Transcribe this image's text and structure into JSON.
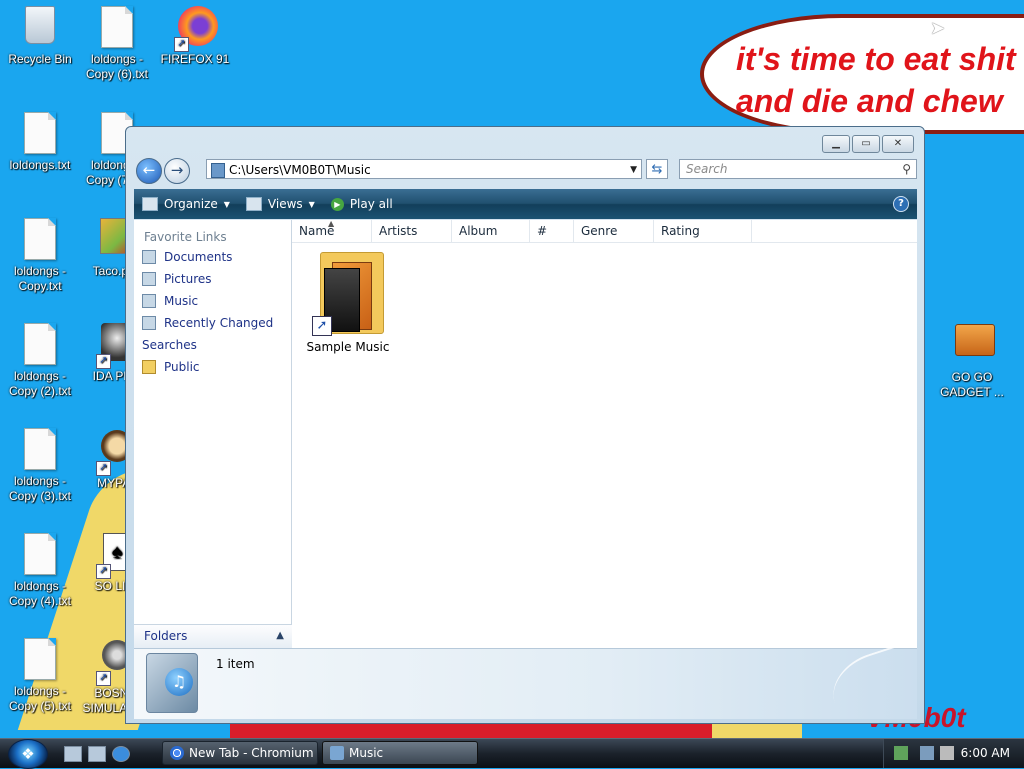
{
  "wallpaper": {
    "line1": "it's time to eat shit",
    "line2": "and die and chew",
    "line3": "bubble",
    "tag": "VM0b0t"
  },
  "desktop_icons": [
    {
      "label": "Recycle Bin"
    },
    {
      "label": "loldongs - Copy (6).txt"
    },
    {
      "label": "FIREFOX 91"
    },
    {
      "label": "loldongs.txt"
    },
    {
      "label": "loldongs - Copy (7).txt"
    },
    {
      "label": "loldongs - Copy.txt"
    },
    {
      "label": "Taco.png"
    },
    {
      "label": "loldongs - Copy (2).txt"
    },
    {
      "label": "IDA PRO"
    },
    {
      "label": "loldongs - Copy (3).txt"
    },
    {
      "label": "MYPAL"
    },
    {
      "label": "loldongs - Copy (4).txt"
    },
    {
      "label": "SO LIT!!"
    },
    {
      "label": "loldongs - Copy (5).txt"
    },
    {
      "label": "BOSNIA SIMULATOR"
    },
    {
      "label": "GO GO GADGET ..."
    }
  ],
  "window": {
    "title": "Music",
    "address": "C:\\Users\\VM0B0T\\Music",
    "search_placeholder": "Search",
    "toolbar": {
      "organize": "Organize",
      "views": "Views",
      "play_all": "Play all"
    },
    "favorite_links_title": "Favorite Links",
    "favorite_links": [
      {
        "label": "Documents"
      },
      {
        "label": "Pictures"
      },
      {
        "label": "Music"
      },
      {
        "label": "Recently Changed"
      },
      {
        "label": "Searches"
      },
      {
        "label": "Public"
      }
    ],
    "folders_label": "Folders",
    "columns": [
      "Name",
      "Artists",
      "Album",
      "#",
      "Genre",
      "Rating"
    ],
    "items": [
      {
        "label": "Sample Music"
      }
    ],
    "details_count": "1 item"
  },
  "taskbar": {
    "buttons": [
      {
        "label": "New Tab - Chromium"
      },
      {
        "label": "Music"
      }
    ],
    "clock": "6:00 AM"
  }
}
